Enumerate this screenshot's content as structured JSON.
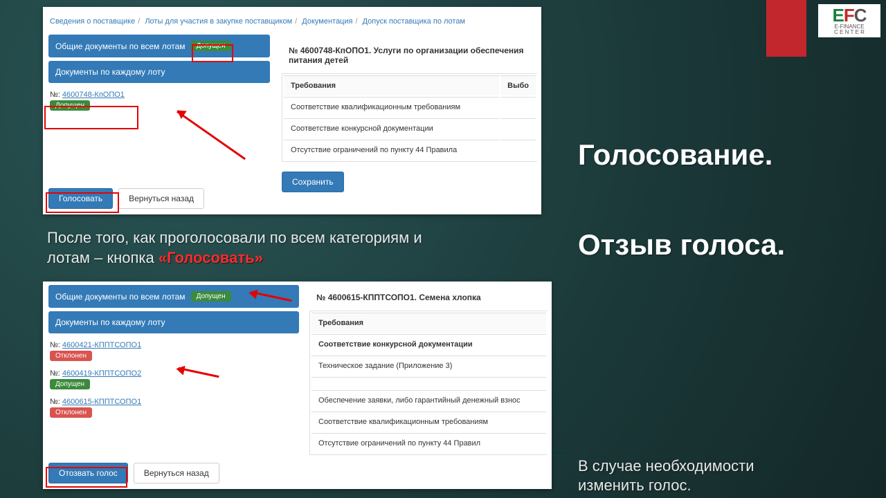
{
  "decor": {
    "logo_efc_e": "E",
    "logo_efc_f": "F",
    "logo_efc_c": "C",
    "logo_sub1": "E-FINANCE",
    "logo_sub2": "C E N T E R"
  },
  "titles": {
    "t1": "Голосование.",
    "t2": "Отзыв голоса."
  },
  "caption_left_line1": "После того, как проголосовали по всем категориям и",
  "caption_left_line2_a": "лотам – кнопка ",
  "caption_left_line2_b": "«Голосовать»",
  "caption_right_line1": "В случае необходимости",
  "caption_right_line2": "изменить голос.",
  "shot1": {
    "breadcrumb": [
      "Сведения о поставщике",
      "Лоты для участия в закупке поставщиком",
      "Документация",
      "Допуск поставщика по лотам"
    ],
    "panel_all": "Общие документы по всем лотам",
    "badge_allowed": "Допущен",
    "panel_each": "Документы по каждому лоту",
    "lot": {
      "prefix": "№:",
      "id": "4600748-КпОПО1",
      "status": "Допущен"
    },
    "right_header": "№ 4600748-КпОПО1. Услуги по организации обеспечения питания детей",
    "table_h1": "Требования",
    "table_h2": "Выбо",
    "rows": [
      "Соответствие квалификационным требованиям",
      "Соответствие конкурсной документации",
      "Отсутствие ограничений по пункту 44 Правила"
    ],
    "btn_save": "Сохранить",
    "btn_vote": "Голосовать",
    "btn_back": "Вернуться назад"
  },
  "shot2": {
    "panel_all": "Общие документы по всем лотам",
    "badge_allowed": "Допущен",
    "panel_each": "Документы по каждому лоту",
    "lots": [
      {
        "prefix": "№:",
        "id": "4600421-КППТСОПО1",
        "status": "Отклонен",
        "status_class": "red"
      },
      {
        "prefix": "№:",
        "id": "4600419-КППТСОПО2",
        "status": "Допущен",
        "status_class": "green"
      },
      {
        "prefix": "№:",
        "id": "4600615-КППТСОПО1",
        "status": "Отклонен",
        "status_class": "red"
      }
    ],
    "right_header": "№ 4600615-КППТСОПО1. Семена хлопка",
    "table_h1": "Требования",
    "rows": [
      "Соответствие конкурсной документации",
      "Техническое задание (Приложение 3)",
      "",
      "Обеспечение заявки, либо гарантийный денежный взнос",
      "Соответствие квалификационным требованиям",
      "Отсутствие ограничений по пункту 44 Правил"
    ],
    "btn_recall": "Отозвать голос",
    "btn_back": "Вернуться назад"
  }
}
